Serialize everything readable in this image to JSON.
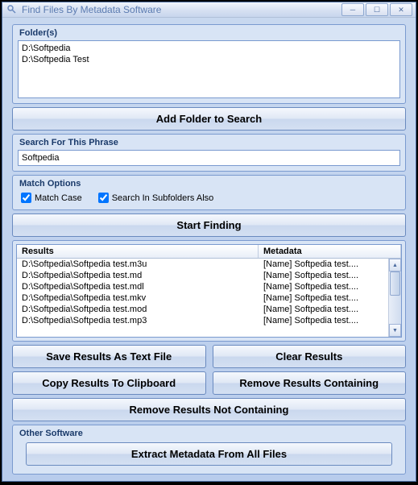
{
  "window": {
    "title": "Find Files By Metadata Software"
  },
  "folders": {
    "legend": "Folder(s)",
    "items": [
      "D:\\Softpedia",
      "D:\\Softpedia Test"
    ]
  },
  "addFolderBtn": "Add Folder to Search",
  "search": {
    "legend": "Search For This Phrase",
    "value": "Softpedia"
  },
  "match": {
    "legend": "Match Options",
    "caseLabel": "Match Case",
    "subfoldersLabel": "Search In Subfolders Also",
    "caseChecked": true,
    "subfoldersChecked": true
  },
  "startBtn": "Start Finding",
  "results": {
    "headers": {
      "file": "Results",
      "meta": "Metadata"
    },
    "rows": [
      {
        "file": "D:\\Softpedia\\Softpedia test.m3u",
        "meta": "[Name] Softpedia test...."
      },
      {
        "file": "D:\\Softpedia\\Softpedia test.md",
        "meta": "[Name] Softpedia test...."
      },
      {
        "file": "D:\\Softpedia\\Softpedia test.mdl",
        "meta": "[Name] Softpedia test...."
      },
      {
        "file": "D:\\Softpedia\\Softpedia test.mkv",
        "meta": "[Name] Softpedia test...."
      },
      {
        "file": "D:\\Softpedia\\Softpedia test.mod",
        "meta": "[Name] Softpedia test...."
      },
      {
        "file": "D:\\Softpedia\\Softpedia test.mp3",
        "meta": "[Name] Softpedia test...."
      }
    ]
  },
  "buttons": {
    "saveText": "Save Results As Text File",
    "clear": "Clear Results",
    "copy": "Copy Results To Clipboard",
    "removeContaining": "Remove Results Containing",
    "removeNotContaining": "Remove Results Not Containing"
  },
  "other": {
    "legend": "Other Software",
    "extractBtn": "Extract Metadata From All Files"
  }
}
